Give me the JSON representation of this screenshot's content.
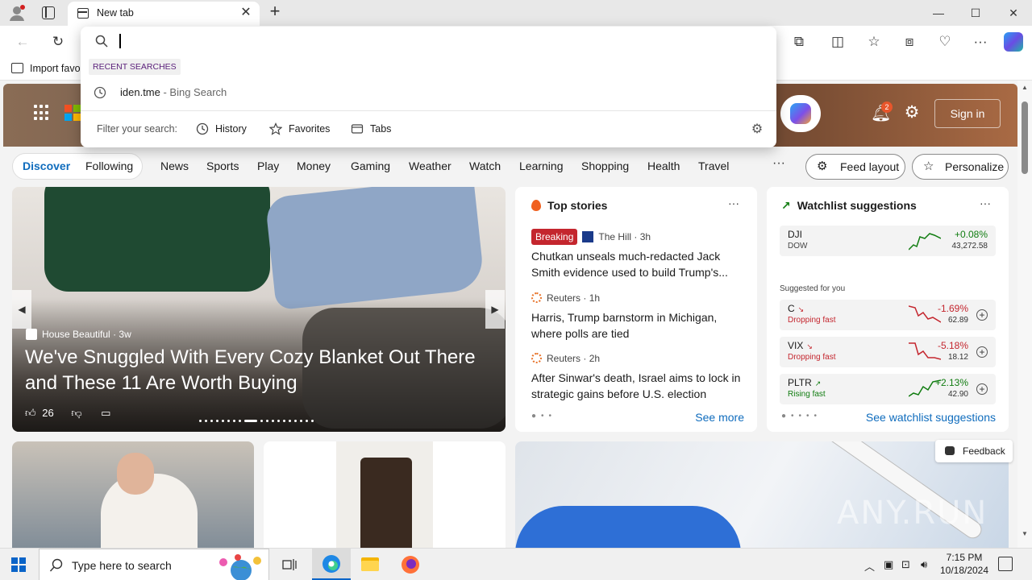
{
  "browser": {
    "tab_title": "New tab",
    "window_controls": {
      "minimize": "—",
      "maximize": "☐",
      "close": "✕"
    }
  },
  "favorites_bar": {
    "import_label": "Import favo"
  },
  "omnibox": {
    "query": "",
    "recent_searches_label": "RECENT SEARCHES",
    "recent_items": [
      {
        "text": "iden.tme",
        "engine": " - Bing Search"
      }
    ],
    "filter_label": "Filter your search:",
    "filters": [
      "History",
      "Favorites",
      "Tabs"
    ]
  },
  "header": {
    "sign_in": "Sign in",
    "notification_count": "2"
  },
  "nav": {
    "pills": [
      "Discover",
      "Following"
    ],
    "active_pill": "Discover",
    "items": [
      "News",
      "Sports",
      "Play",
      "Money",
      "Gaming",
      "Weather",
      "Watch",
      "Learning",
      "Shopping",
      "Health",
      "Travel"
    ],
    "more": "···",
    "feed_layout": "Feed layout",
    "personalize": "Personalize"
  },
  "hero": {
    "source": "House Beautiful",
    "age": "3w",
    "title": "We've Snuggled With Every Cozy Blanket Out There and These 11 Are Worth Buying",
    "likes": "26"
  },
  "top_stories": {
    "heading": "Top stories",
    "stories": [
      {
        "badge": "Breaking",
        "source": "The Hill",
        "age": "3h",
        "title": "Chutkan unseals much-redacted Jack Smith evidence used to build Trump's..."
      },
      {
        "badge": "",
        "source": "Reuters",
        "age": "1h",
        "title": "Harris, Trump barnstorm in Michigan, where polls are tied"
      },
      {
        "badge": "",
        "source": "Reuters",
        "age": "2h",
        "title": "After Sinwar's death, Israel aims to lock in strategic gains before U.S. election"
      }
    ],
    "see_more": "See more"
  },
  "watchlist": {
    "heading": "Watchlist suggestions",
    "dji": {
      "symbol": "DJI",
      "name": "DOW",
      "change": "+0.08%",
      "price": "43,272.58"
    },
    "suggested_label": "Suggested for you",
    "items": [
      {
        "symbol": "C",
        "status": "Dropping fast",
        "change": "-1.69%",
        "price": "62.89",
        "direction": "down"
      },
      {
        "symbol": "VIX",
        "status": "Dropping fast",
        "change": "-5.18%",
        "price": "18.12",
        "direction": "down"
      },
      {
        "symbol": "PLTR",
        "status": "Rising fast",
        "change": "+2.13%",
        "price": "42.90",
        "direction": "up"
      }
    ],
    "see_suggestions": "See watchlist suggestions"
  },
  "feedback": {
    "label": "Feedback"
  },
  "watermark": "ANY.RUN",
  "taskbar": {
    "search_placeholder": "Type here to search",
    "time": "7:15 PM",
    "date": "10/18/2024"
  },
  "colors": {
    "accent": "#0f6cbd",
    "breaking": "#c4262e",
    "up": "#107c10",
    "down": "#c4262e"
  }
}
